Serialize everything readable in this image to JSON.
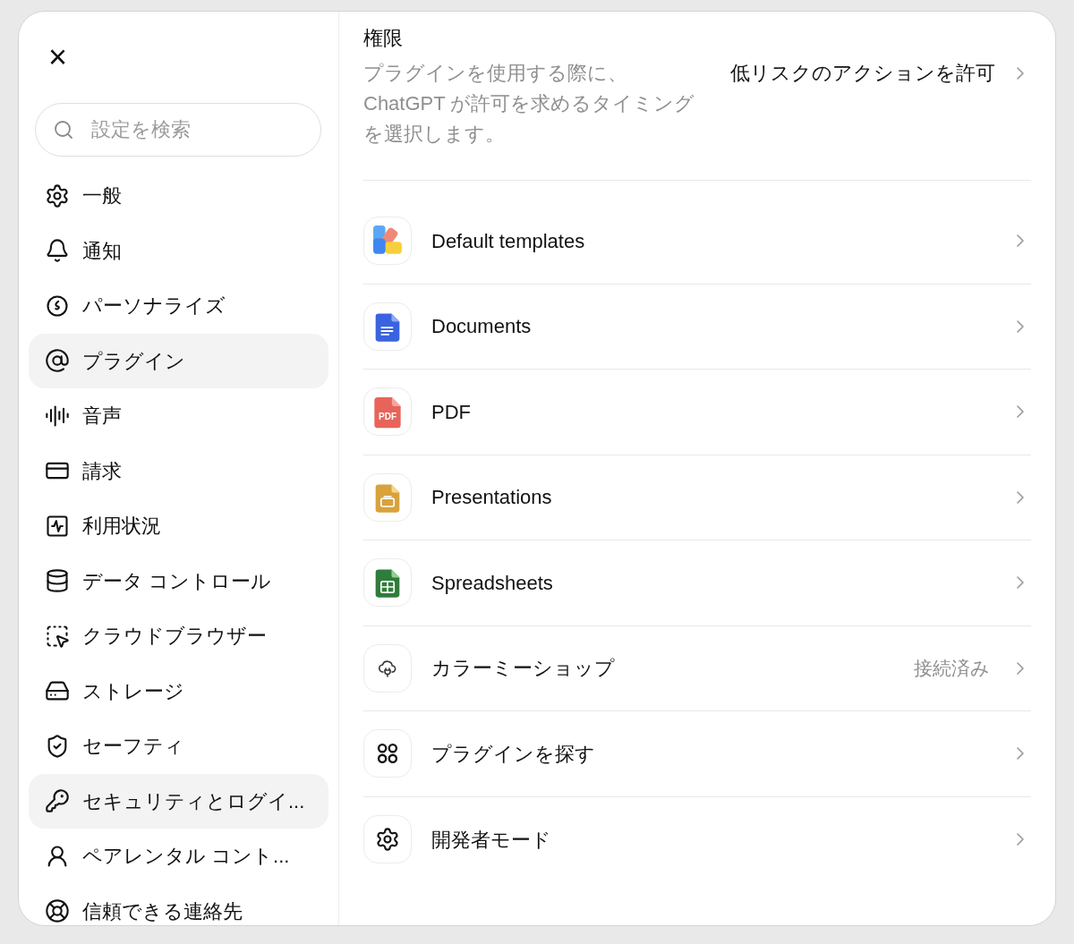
{
  "close_button": {
    "label": "×"
  },
  "search": {
    "placeholder": "設定を検索"
  },
  "sidebar": {
    "items": [
      {
        "label": "一般",
        "highlighted": false
      },
      {
        "label": "通知",
        "highlighted": false
      },
      {
        "label": "パーソナライズ",
        "highlighted": false
      },
      {
        "label": "プラグイン",
        "highlighted": true
      },
      {
        "label": "音声",
        "highlighted": false
      },
      {
        "label": "請求",
        "highlighted": false
      },
      {
        "label": "利用状況",
        "highlighted": false
      },
      {
        "label": "データ コントロール",
        "highlighted": false
      },
      {
        "label": "クラウドブラウザー",
        "highlighted": false
      },
      {
        "label": "ストレージ",
        "highlighted": false
      },
      {
        "label": "セーフティ",
        "highlighted": false
      },
      {
        "label": "セキュリティとログイ...",
        "highlighted": true
      },
      {
        "label": "ペアレンタル コント...",
        "highlighted": false
      },
      {
        "label": "信頼できる連絡先",
        "highlighted": false
      }
    ]
  },
  "permissions": {
    "title": "権限",
    "description": "プラグインを使用する際に、ChatGPT が許可を求めるタイミングを選択します。",
    "value": "低リスクのアクションを許可"
  },
  "plugins": [
    {
      "name": "Default templates"
    },
    {
      "name": "Documents"
    },
    {
      "name": "PDF",
      "icon_label": "PDF"
    },
    {
      "name": "Presentations"
    },
    {
      "name": "Spreadsheets"
    },
    {
      "name": "カラーミーショップ",
      "status": "接続済み"
    },
    {
      "name": "プラグインを探す"
    },
    {
      "name": "開発者モード"
    }
  ]
}
